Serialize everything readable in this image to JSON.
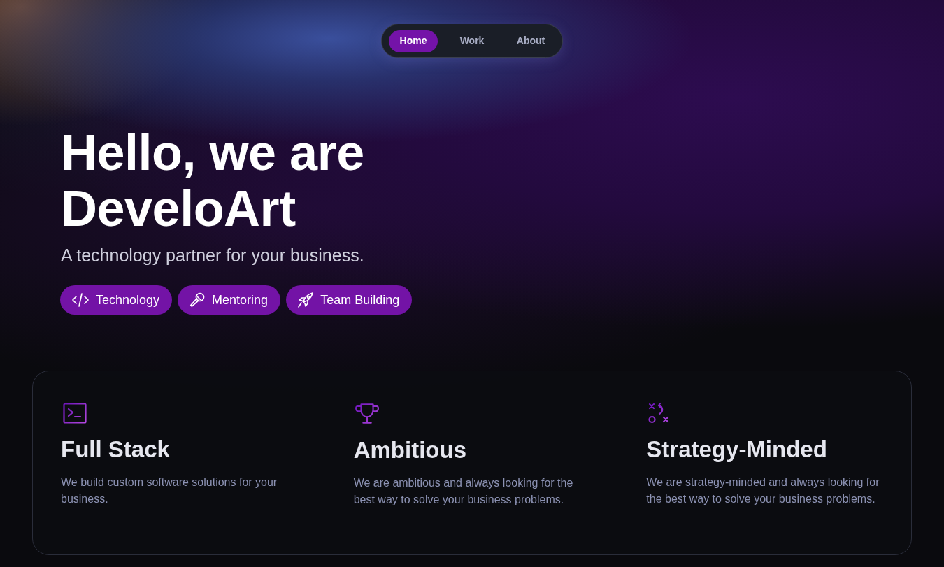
{
  "nav": {
    "items": [
      {
        "label": "Home",
        "selected": true
      },
      {
        "label": "Work",
        "selected": false
      },
      {
        "label": "About",
        "selected": false
      }
    ]
  },
  "hero": {
    "title_lines": [
      "Hello, we are",
      "DeveloArt"
    ],
    "subtitle": "A technology partner for your business.",
    "tags": [
      {
        "label": "Technology"
      },
      {
        "label": "Mentoring"
      },
      {
        "label": "Team Building"
      }
    ]
  },
  "features": [
    {
      "title": "Full Stack",
      "description": "We build custom software solutions for your business."
    },
    {
      "title": "Ambitious",
      "description": "We are ambitious and always looking for the best way to solve your business problems."
    },
    {
      "title": "Strategy-Minded",
      "description": "We are strategy-minded and always looking for the best way to solve your business problems."
    }
  ]
}
